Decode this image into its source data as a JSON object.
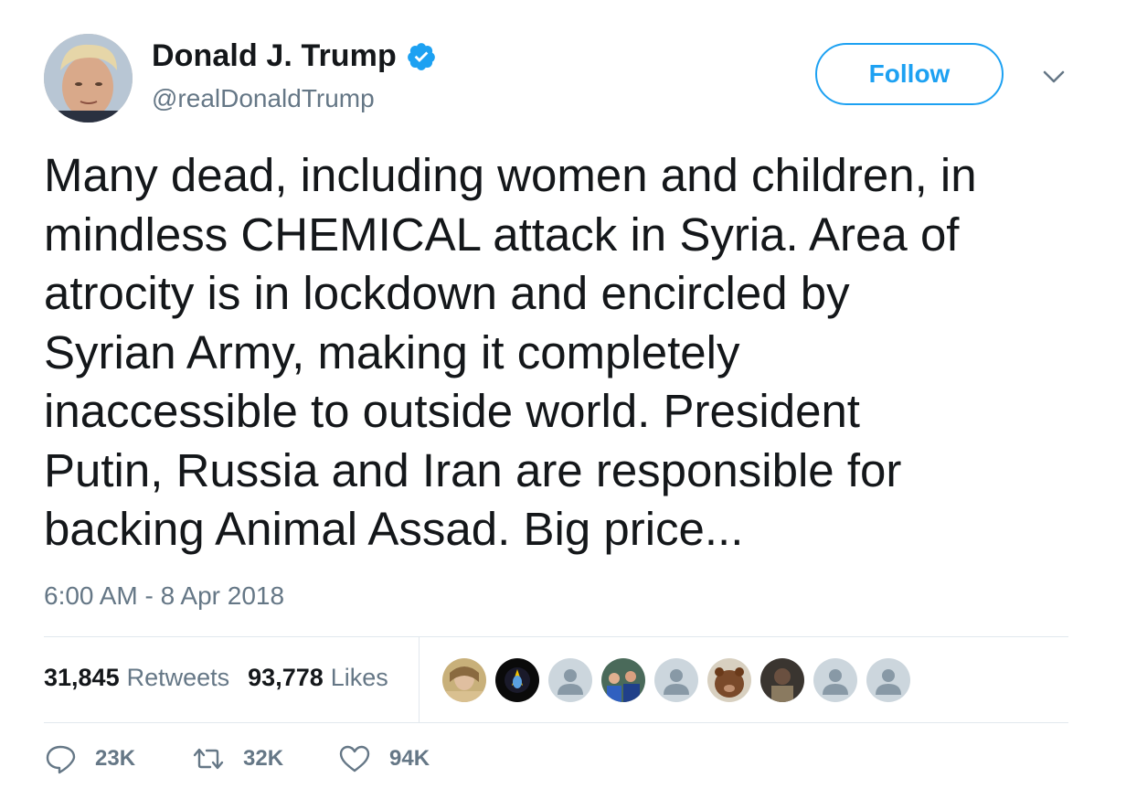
{
  "author": {
    "name": "Donald J. Trump",
    "handle": "@realDonaldTrump",
    "verified": true
  },
  "follow_label": "Follow",
  "tweet_lines": [
    "Many dead, including women and children, in",
    "mindless CHEMICAL attack in Syria. Area of",
    "atrocity is in lockdown and encircled by",
    "Syrian Army, making it completely",
    "inaccessible to outside world. President",
    "Putin, Russia and Iran are responsible for",
    "backing Animal Assad. Big price..."
  ],
  "timestamp": "6:00 AM - 8 Apr 2018",
  "stats": {
    "retweets": {
      "count": "31,845",
      "label": "Retweets"
    },
    "likes": {
      "count": "93,778",
      "label": "Likes"
    }
  },
  "likers": [
    "photo",
    "logo",
    "default",
    "photo",
    "default",
    "photo",
    "photo",
    "default",
    "default"
  ],
  "actions": {
    "replies": "23K",
    "retweets": "32K",
    "likes": "94K"
  },
  "colors": {
    "accent": "#1da1f2",
    "text": "#14171a",
    "secondary": "#657786",
    "divider": "#e1e8ed"
  },
  "icons": {
    "verified": "verified-badge-icon",
    "caret": "chevron-down-icon",
    "reply": "reply-icon",
    "retweet": "retweet-icon",
    "like": "heart-icon"
  }
}
